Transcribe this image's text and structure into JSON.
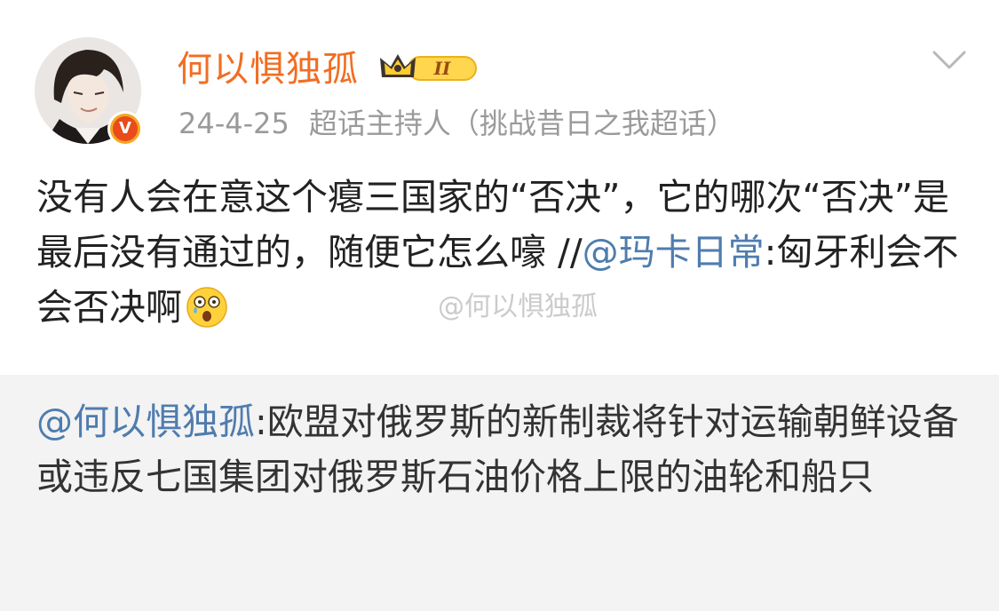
{
  "header": {
    "username": "何以惧独孤",
    "level_badge": "II",
    "date": "24-4-25",
    "source": "超话主持人（挑战昔日之我超话）",
    "verified_badge": "V",
    "avatar_icon": "avatar-icon",
    "expand_icon": "chevron-down-icon"
  },
  "post": {
    "text": "没有人会在意这个瘪三国家的“否决”，它的哪次“否决”是最后没有通过的，随便它怎么嚎 //",
    "mention": "@玛卡日常",
    "reply": ":匈牙利会不会否决啊",
    "emoji": "shocked-crying-emoji"
  },
  "watermark": "@何以惧独孤",
  "repost": {
    "mention": "@何以惧独孤",
    "text": ":欧盟对俄罗斯的新制裁将针对运输朝鲜设备或违反七国集团对俄罗斯石油价格上限的油轮和船只"
  },
  "colors": {
    "username": "#f26d22",
    "link": "#4f7cae",
    "meta": "#9a9a9a",
    "repost_bg": "#f3f3f3"
  }
}
